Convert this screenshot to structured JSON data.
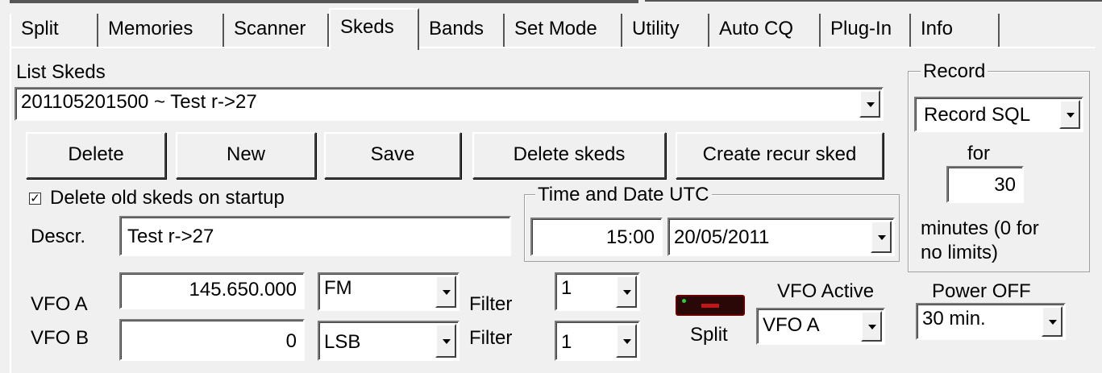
{
  "tabs": [
    "Split",
    "Memories",
    "Scanner",
    "Skeds",
    "Bands",
    "Set Mode",
    "Utility",
    "Auto CQ",
    "Plug-In",
    "Info"
  ],
  "list_skeds": {
    "label": "List Skeds",
    "value": "201105201500 ~ Test  r->27"
  },
  "buttons": {
    "delete": "Delete",
    "new": "New",
    "save": "Save",
    "delete_skeds": "Delete skeds",
    "create_recur": "Create recur sked"
  },
  "delete_old": {
    "label": "Delete old skeds on startup",
    "checked": true,
    "mark": "✓"
  },
  "descr": {
    "label": "Descr.",
    "value": "Test  r->27"
  },
  "time_date": {
    "legend": "Time and Date UTC",
    "time": "15:00",
    "date": "20/05/2011"
  },
  "record": {
    "legend": "Record",
    "mode": "Record SQL",
    "for_label": "for",
    "minutes": "30",
    "minutes_label_1": "minutes (0 for",
    "minutes_label_2": "no limits)"
  },
  "vfo_a": {
    "label": "VFO A",
    "freq": "145.650.000",
    "mode": "FM",
    "filter_label": "Filter",
    "filter": "1"
  },
  "vfo_b": {
    "label": "VFO B",
    "freq": "0",
    "mode": "LSB",
    "filter_label": "Filter",
    "filter": "1"
  },
  "split": {
    "label": "Split"
  },
  "vfo_active": {
    "label": "VFO Active",
    "value": "VFO A"
  },
  "power_off": {
    "label": "Power OFF",
    "value": "30 min."
  }
}
